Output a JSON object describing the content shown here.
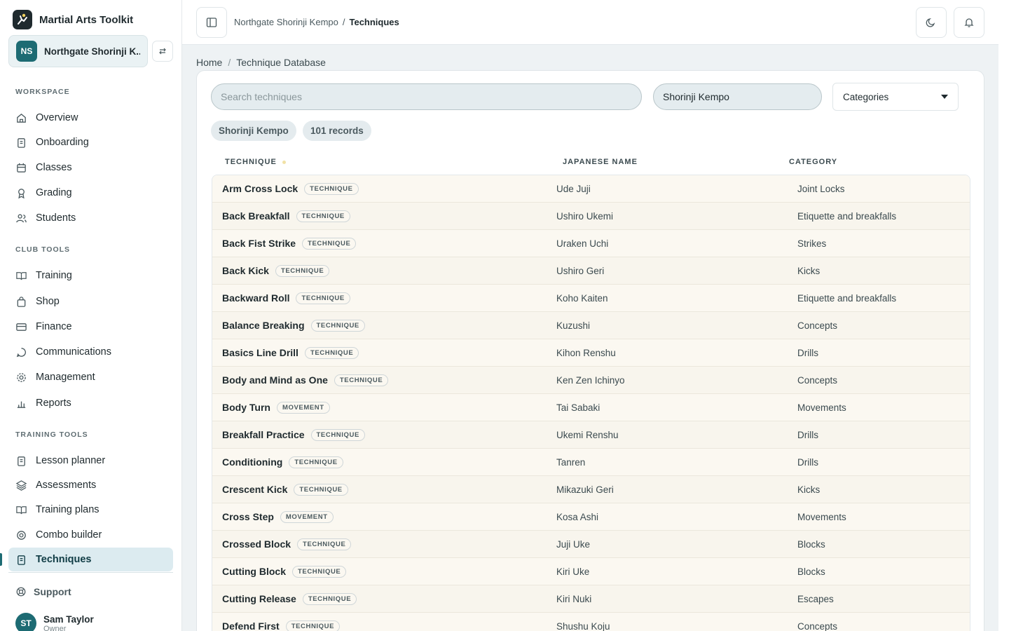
{
  "app": {
    "name": "Martial Arts Toolkit"
  },
  "club": {
    "initials": "NS",
    "name": "Northgate Shorinji K..."
  },
  "sidebar": {
    "sections": [
      {
        "label": "WORKSPACE",
        "items": [
          "Overview",
          "Onboarding",
          "Classes",
          "Grading",
          "Students"
        ]
      },
      {
        "label": "CLUB TOOLS",
        "items": [
          "Training",
          "Shop",
          "Finance",
          "Communications",
          "Management",
          "Reports"
        ]
      },
      {
        "label": "TRAINING TOOLS",
        "items": [
          "Lesson planner",
          "Assessments",
          "Training plans",
          "Combo builder",
          "Techniques"
        ]
      }
    ],
    "active_item": "Techniques",
    "support_label": "Support"
  },
  "user": {
    "initials": "ST",
    "name": "Sam Taylor",
    "role": "Owner"
  },
  "topbar": {
    "crumb_parent": "Northgate Shorinji Kempo",
    "crumb_sep": "/",
    "crumb_current": "Techniques"
  },
  "breadcrumb": {
    "home": "Home",
    "sep": "/",
    "current": "Technique Database"
  },
  "filters": {
    "search_placeholder": "Search techniques",
    "style_value": "Shorinji Kempo",
    "category_label": "Categories"
  },
  "chips": {
    "style": "Shorinji Kempo",
    "count": "101 records"
  },
  "table": {
    "columns": [
      "TECHNIQUE",
      "JAPANESE NAME",
      "CATEGORY"
    ],
    "rows": [
      {
        "name": "Arm Cross Lock",
        "tag": "TECHNIQUE",
        "japanese": "Ude Juji",
        "category": "Joint Locks"
      },
      {
        "name": "Back Breakfall",
        "tag": "TECHNIQUE",
        "japanese": "Ushiro Ukemi",
        "category": "Etiquette and breakfalls"
      },
      {
        "name": "Back Fist Strike",
        "tag": "TECHNIQUE",
        "japanese": "Uraken Uchi",
        "category": "Strikes"
      },
      {
        "name": "Back Kick",
        "tag": "TECHNIQUE",
        "japanese": "Ushiro Geri",
        "category": "Kicks"
      },
      {
        "name": "Backward Roll",
        "tag": "TECHNIQUE",
        "japanese": "Koho Kaiten",
        "category": "Etiquette and breakfalls"
      },
      {
        "name": "Balance Breaking",
        "tag": "TECHNIQUE",
        "japanese": "Kuzushi",
        "category": "Concepts"
      },
      {
        "name": "Basics Line Drill",
        "tag": "TECHNIQUE",
        "japanese": "Kihon Renshu",
        "category": "Drills"
      },
      {
        "name": "Body and Mind as One",
        "tag": "TECHNIQUE",
        "japanese": "Ken Zen Ichinyo",
        "category": "Concepts"
      },
      {
        "name": "Body Turn",
        "tag": "MOVEMENT",
        "japanese": "Tai Sabaki",
        "category": "Movements"
      },
      {
        "name": "Breakfall Practice",
        "tag": "TECHNIQUE",
        "japanese": "Ukemi Renshu",
        "category": "Drills"
      },
      {
        "name": "Conditioning",
        "tag": "TECHNIQUE",
        "japanese": "Tanren",
        "category": "Drills"
      },
      {
        "name": "Crescent Kick",
        "tag": "TECHNIQUE",
        "japanese": "Mikazuki Geri",
        "category": "Kicks"
      },
      {
        "name": "Cross Step",
        "tag": "MOVEMENT",
        "japanese": "Kosa Ashi",
        "category": "Movements"
      },
      {
        "name": "Crossed Block",
        "tag": "TECHNIQUE",
        "japanese": "Juji Uke",
        "category": "Blocks"
      },
      {
        "name": "Cutting Block",
        "tag": "TECHNIQUE",
        "japanese": "Kiri Uke",
        "category": "Blocks"
      },
      {
        "name": "Cutting Release",
        "tag": "TECHNIQUE",
        "japanese": "Kiri Nuki",
        "category": "Escapes"
      },
      {
        "name": "Defend First",
        "tag": "TECHNIQUE",
        "japanese": "Shushu Koju",
        "category": "Concepts"
      }
    ]
  },
  "colors": {
    "accent": "#1d6b73",
    "active_bg": "#dcebf0",
    "row_bg": "#fbf8f1"
  }
}
